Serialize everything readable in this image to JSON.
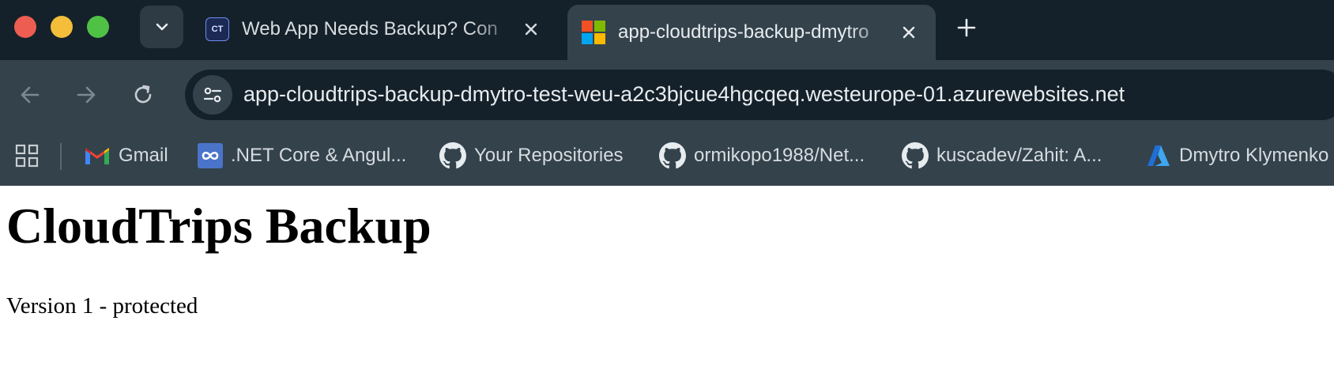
{
  "window": {
    "controls": [
      "close",
      "minimize",
      "maximize"
    ],
    "colors": {
      "close": "#ee5d52",
      "minimize": "#f4bd3a",
      "maximize": "#4fc145"
    }
  },
  "tabs": [
    {
      "title": "Web App Needs Backup? Con",
      "favicon": "CT",
      "favicon_icon": "cloudtrips-icon",
      "active": false
    },
    {
      "title": "app-cloudtrips-backup-dmytro",
      "favicon_icon": "microsoft-icon",
      "active": true
    }
  ],
  "toolbar": {
    "url": "app-cloudtrips-backup-dmytro-test-weu-a2c3bjcue4hgcqeq.westeurope-01.azurewebsites.net",
    "icons": [
      "back-icon",
      "forward-icon",
      "reload-icon",
      "site-info-icon"
    ]
  },
  "bookmarks": [
    {
      "label": "Gmail",
      "icon": "gmail-icon"
    },
    {
      "label": ".NET Core & Angul...",
      "icon": "dotnet-icon"
    },
    {
      "label": "Your Repositories",
      "icon": "github-icon"
    },
    {
      "label": "ormikopo1988/Net...",
      "icon": "github-icon"
    },
    {
      "label": "kuscadev/Zahit: A...",
      "icon": "github-icon"
    },
    {
      "label": "Dmytro Klymenko",
      "icon": "azure-icon"
    }
  ],
  "page": {
    "heading": "CloudTrips Backup",
    "paragraph": "Version 1 - protected"
  }
}
